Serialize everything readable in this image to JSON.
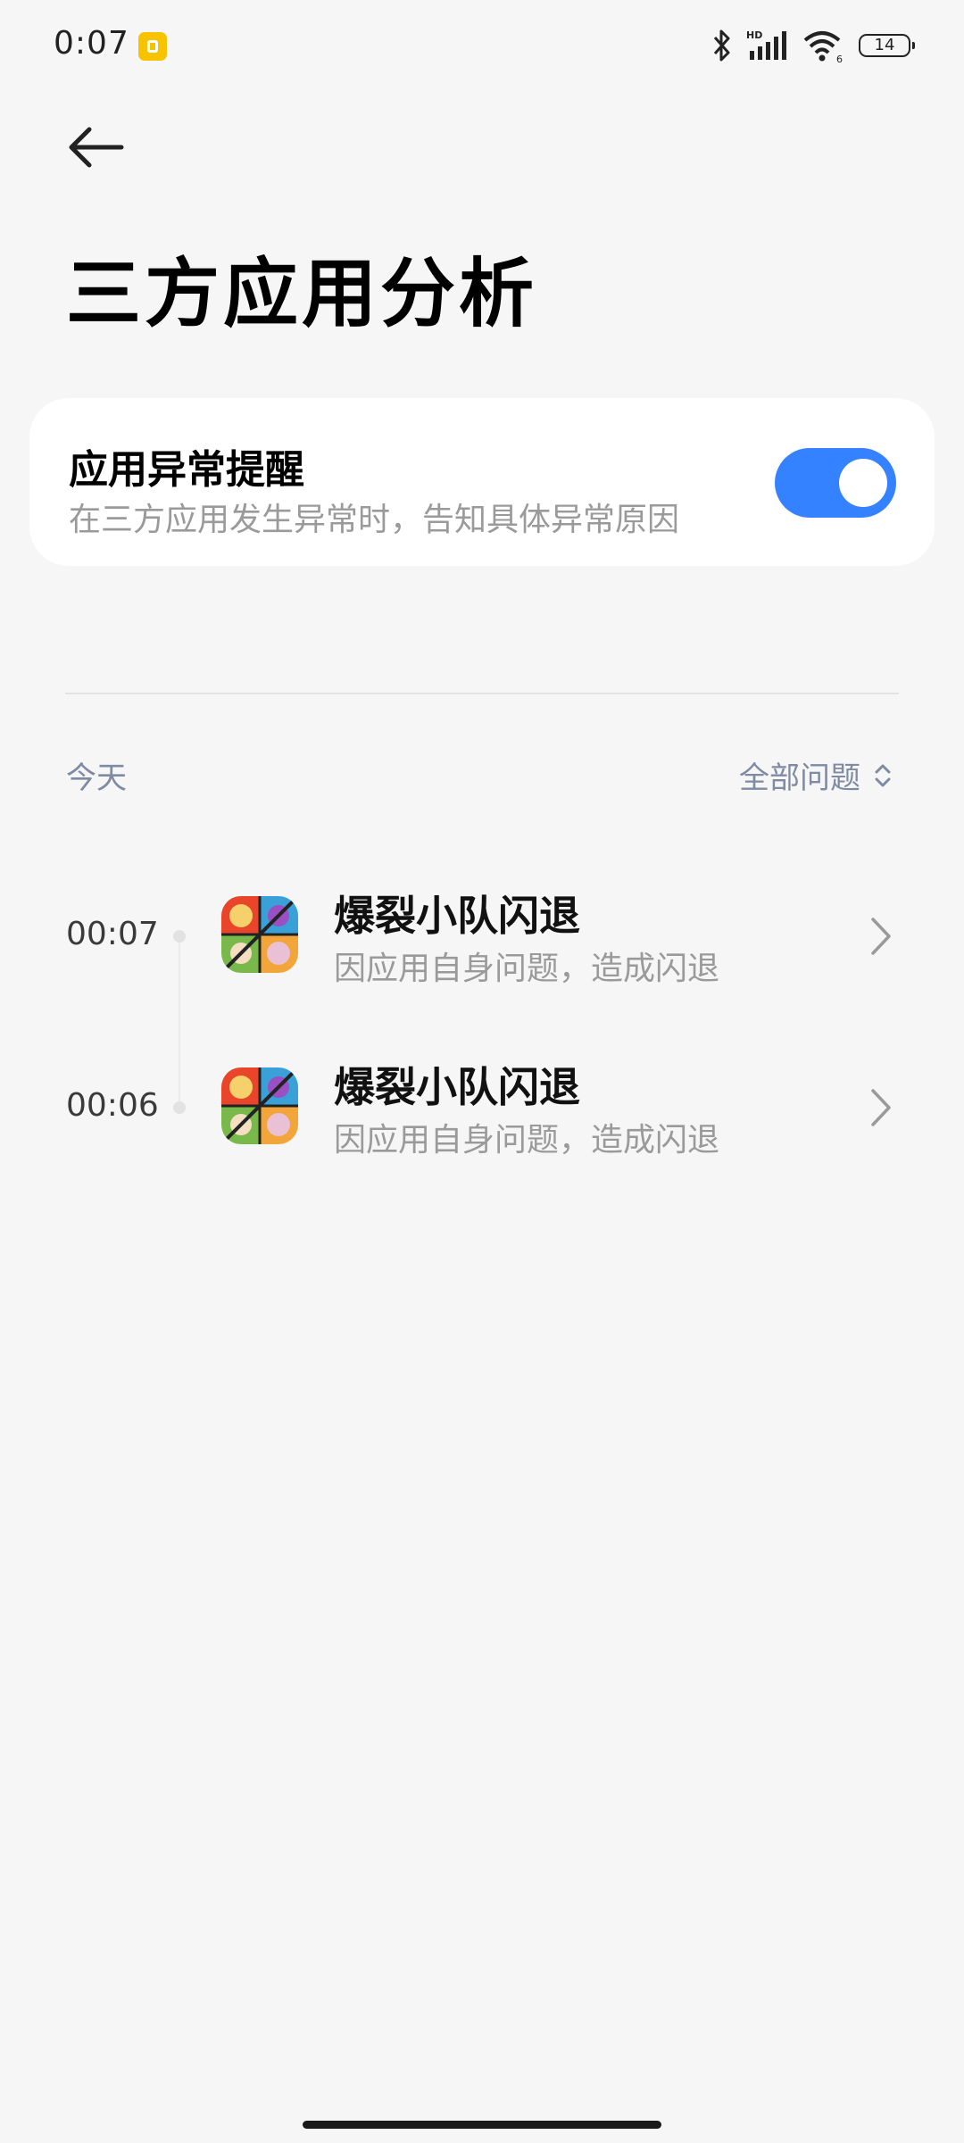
{
  "status_bar": {
    "time": "0:07",
    "battery": "14",
    "icons": [
      "app-notification-icon",
      "bluetooth-icon",
      "hd-signal-icon",
      "wifi-icon",
      "battery-icon"
    ]
  },
  "header": {
    "title": "三方应用分析"
  },
  "alert_setting": {
    "title": "应用异常提醒",
    "subtitle": "在三方应用发生异常时，告知具体异常原因",
    "enabled": true,
    "accent": "#3482ff"
  },
  "log": {
    "date_label": "今天",
    "filter_label": "全部问题",
    "entries": [
      {
        "time": "00:07",
        "title": "爆裂小队闪退",
        "description": "因应用自身问题，造成闪退"
      },
      {
        "time": "00:06",
        "title": "爆裂小队闪退",
        "description": "因应用自身问题，造成闪退"
      }
    ]
  }
}
